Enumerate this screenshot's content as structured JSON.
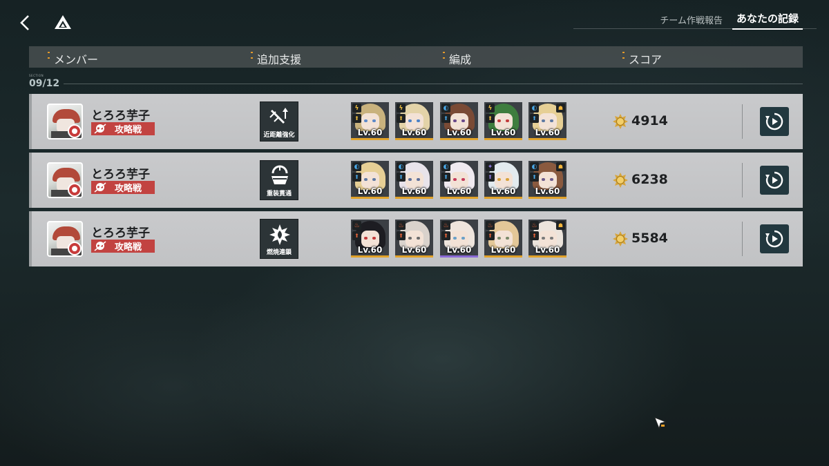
{
  "nav": {
    "back_icon": "chevron-left-icon",
    "logo_icon": "triangle-logo-icon",
    "tabs": [
      {
        "label": "チーム作戦報告",
        "active": false
      },
      {
        "label": "あなたの記録",
        "active": true
      }
    ]
  },
  "table": {
    "headers": {
      "member": "メンバー",
      "support": "追加支援",
      "formation": "編成",
      "score": "スコア"
    }
  },
  "section": {
    "label": "SECTION",
    "date": "09/12"
  },
  "records": [
    {
      "player_name": "とろろ芋子",
      "mode": "攻略戦",
      "support_label": "近距離強化",
      "support_icon": "close-range-boost-icon",
      "score": "4914",
      "characters": [
        {
          "level": "Lv.60",
          "element": "electric",
          "hair": "#c9b27d",
          "eyes": "#5d8ac9"
        },
        {
          "level": "Lv.60",
          "element": "electric",
          "hair": "#e3d3a8",
          "eyes": "#4b82c7"
        },
        {
          "level": "Lv.60",
          "element": "water",
          "hair": "#7a4a35",
          "eyes": "#6a4a8a"
        },
        {
          "level": "Lv.60",
          "element": "electric",
          "hair": "#3e7d3e",
          "eyes": "#c33b3b"
        },
        {
          "level": "Lv.60",
          "element": "water",
          "hair": "#e6cf95",
          "eyes": "#5f7aa3",
          "extra": true
        }
      ]
    },
    {
      "player_name": "とろろ芋子",
      "mode": "攻略戦",
      "support_label": "重装貫通",
      "support_icon": "heavy-pierce-icon",
      "score": "6238",
      "characters": [
        {
          "level": "Lv.60",
          "element": "water",
          "hair": "#e6cf95",
          "eyes": "#5f7aa3"
        },
        {
          "level": "Lv.60",
          "element": "water",
          "hair": "#e8e3ea",
          "eyes": "#5d6f9a"
        },
        {
          "level": "Lv.60",
          "element": "water",
          "hair": "#f0eaf0",
          "eyes": "#c53a5b"
        },
        {
          "level": "Lv.60",
          "element": "wind",
          "hair": "#e3ebef",
          "eyes": "#d8a23a"
        },
        {
          "level": "Lv.60",
          "element": "water",
          "hair": "#8a5a3f",
          "eyes": "#6a5a8a",
          "extra": true
        }
      ]
    },
    {
      "player_name": "とろろ芋子",
      "mode": "攻略戦",
      "support_label": "燃焼連鎖",
      "support_icon": "burn-chain-icon",
      "score": "5584",
      "characters": [
        {
          "level": "Lv.60",
          "element": "fire",
          "hair": "#1d1d22",
          "eyes": "#c23b3b"
        },
        {
          "level": "Lv.60",
          "element": "fire",
          "hair": "#d9d2cc",
          "eyes": "#6b6b6b"
        },
        {
          "level": "Lv.60",
          "element": "fire",
          "hair": "#efe5dd",
          "eyes": "#6aa0c8",
          "border": "purple"
        },
        {
          "level": "Lv.60",
          "element": "fire",
          "hair": "#e3c798",
          "eyes": "#7a8a6a"
        },
        {
          "level": "Lv.60",
          "element": "fire",
          "hair": "#ece4dc",
          "eyes": "#7a7a7a",
          "extra": true
        }
      ]
    }
  ],
  "colors": {
    "mode_badge": "#c24341",
    "replay_button": "#22383f",
    "level_gold": "#e1a229",
    "electric": "#f1c040",
    "water": "#4aa9e8",
    "wind": "#8f7ae0",
    "fire": "#e8653a"
  }
}
